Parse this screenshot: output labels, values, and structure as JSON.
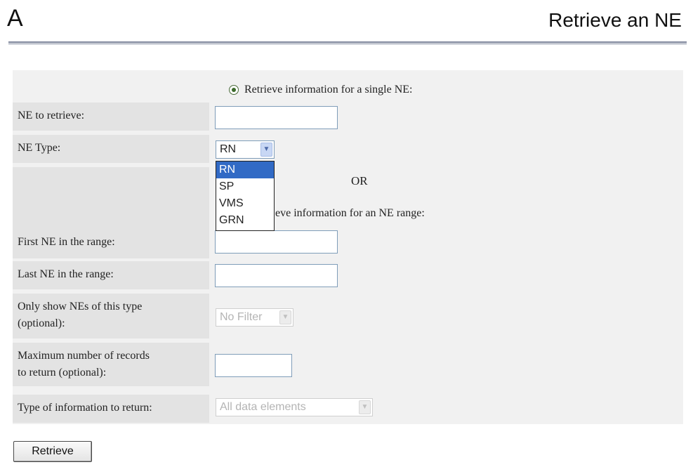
{
  "header": {
    "panel_letter": "A",
    "title": "Retrieve an NE"
  },
  "form": {
    "single": {
      "radio_label": "Retrieve information for a single NE:",
      "ne_label": "NE to retrieve:",
      "ne_value": "",
      "type_label": "NE Type:",
      "type_selected": "RN",
      "type_options": [
        "RN",
        "SP",
        "VMS",
        "GRN"
      ],
      "type_highlighted": "RN"
    },
    "or_text": "OR",
    "range": {
      "radio_label_visible": "eve information for an NE range:",
      "first_label": "First NE in the range:",
      "first_value": "",
      "last_label": "Last NE in the range:",
      "last_value": "",
      "filter_label_line1": "Only show NEs of this type",
      "filter_label_line2": "(optional):",
      "filter_selected": "No Filter",
      "max_label_line1": "Maximum number of records",
      "max_label_line2": "to return (optional):",
      "max_value": "",
      "info_label": "Type of information to return:",
      "info_selected": "All data elements"
    }
  },
  "actions": {
    "retrieve_label": "Retrieve"
  },
  "icons": {
    "dropdown_arrow": "chevron-down-icon",
    "radio_selected": "radio-checked-icon"
  },
  "colors": {
    "highlight": "#316ac5",
    "input_border": "#7f9db9",
    "form_background": "#f1f1f1",
    "label_background": "#e3e3e3"
  }
}
